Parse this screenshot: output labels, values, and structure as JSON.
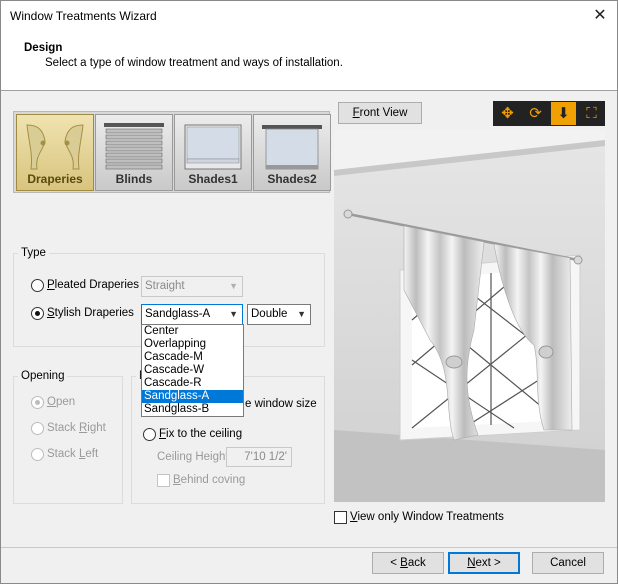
{
  "window": {
    "title": "Window Treatments Wizard",
    "close_glyph": "✕"
  },
  "header": {
    "title": "Design",
    "subtitle": "Select a type of window treatment and ways of installation."
  },
  "toolbar": {
    "items": [
      {
        "label": "Draperies",
        "icon": "draperies-icon",
        "selected": true
      },
      {
        "label": "Blinds",
        "icon": "blinds-icon",
        "selected": false
      },
      {
        "label": "Shades1",
        "icon": "shades1-icon",
        "selected": false
      },
      {
        "label": "Shades2",
        "icon": "shades2-icon",
        "selected": false
      }
    ]
  },
  "type_group": {
    "legend": "Type",
    "pleated": {
      "label_prefix": "",
      "label_ul": "P",
      "label_rest": "leated Draperies",
      "checked": false,
      "combo_value": "Straight"
    },
    "stylish": {
      "label_prefix": "",
      "label_ul": "S",
      "label_rest": "tylish Draperies",
      "checked": true,
      "combo_value": "Sandglass-A",
      "combo2_value": "Double"
    },
    "dropdown_options": [
      "Center",
      "Overlapping",
      "Cascade-M",
      "Cascade-W",
      "Cascade-R",
      "Sandglass-A",
      "Sandglass-B"
    ],
    "dropdown_selected": "Sandglass-A"
  },
  "opening_group": {
    "legend": "Opening",
    "options": [
      {
        "pre": "",
        "ul": "O",
        "post": "pen",
        "checked": true
      },
      {
        "pre": "Stack ",
        "ul": "R",
        "post": "ight",
        "checked": false
      },
      {
        "pre": "Stack ",
        "ul": "L",
        "post": "eft",
        "checked": false
      }
    ]
  },
  "mounting_group": {
    "legend": "M",
    "window_size_text": "e window size",
    "fix_ceiling": {
      "ul": "F",
      "rest": "ix to the ceiling",
      "checked": false
    },
    "ceiling_height_label": "Ceiling Height:",
    "ceiling_height_value": "7'10 1/2'",
    "behind_coving": {
      "ul": "B",
      "rest": "ehind coving",
      "checked": false
    }
  },
  "preview": {
    "front_view_label": "Front View",
    "front_view_ul": "F",
    "front_view_rest": "ront View",
    "icons": [
      "move-icon",
      "rotate-icon",
      "zoom-icon",
      "fit-icon"
    ]
  },
  "view_only": {
    "ul": "V",
    "rest": "iew only Window Treatments",
    "checked": false
  },
  "buttons": {
    "back_pre": "< ",
    "back_ul": "B",
    "back_rest": "ack",
    "next_ul": "N",
    "next_rest": "ext >",
    "cancel": "Cancel"
  },
  "colors": {
    "accent": "#0078d7",
    "selected_tab": "#e3d48f",
    "preview_bg": "#d9d9d9",
    "icon_orange": "#f0a000"
  }
}
